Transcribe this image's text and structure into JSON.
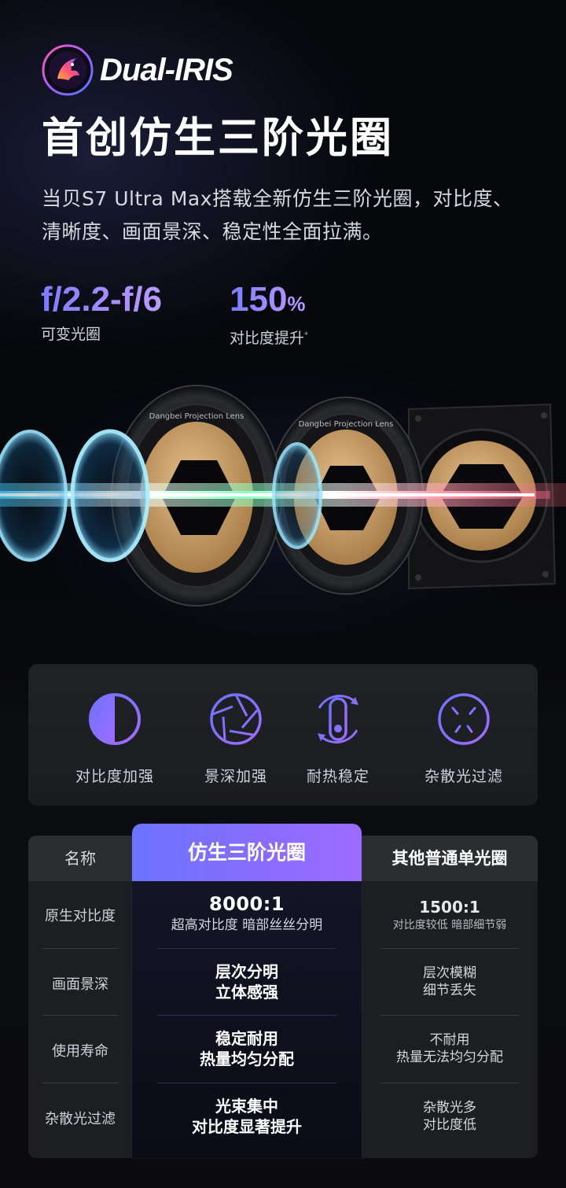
{
  "brand": {
    "name": "Dual-IRIS"
  },
  "headline": "首创仿生三阶光圈",
  "description": "当贝S7 Ultra Max搭载全新仿生三阶光圈，对比度、清晰度、画面景深、稳定性全面拉满。",
  "specs": [
    {
      "value": "f/2.2-f/6",
      "unit": "",
      "label": "可变光圈",
      "mark": ""
    },
    {
      "value": "150",
      "unit": "%",
      "label": "对比度提升",
      "mark": "*"
    }
  ],
  "lens_rings": [
    {
      "text": "Dangbei  Projection Lens"
    },
    {
      "text": "Dangbei  Projection Lens"
    }
  ],
  "features": [
    {
      "icon": "contrast-icon",
      "label": "对比度加强"
    },
    {
      "icon": "aperture-icon",
      "label": "景深加强"
    },
    {
      "icon": "thermometer-icon",
      "label": "耐热稳定"
    },
    {
      "icon": "stray-light-icon",
      "label": "杂散光过滤"
    }
  ],
  "comparison": {
    "headers": {
      "name": "名称",
      "featured": "仿生三阶光圈",
      "other": "其他普通单光圈"
    },
    "rows": [
      {
        "label": "原生对比度",
        "featured_main": "8000:1",
        "featured_sub": "超高对比度 暗部丝丝分明",
        "other_main": "1500:1",
        "other_sub": "对比度较低 暗部细节弱"
      },
      {
        "label": "画面景深",
        "featured_line1": "层次分明",
        "featured_line2": "立体感强",
        "other_line1": "层次模糊",
        "other_line2": "细节丢失"
      },
      {
        "label": "使用寿命",
        "featured_line1": "稳定耐用",
        "featured_line2": "热量均匀分配",
        "other_line1": "不耐用",
        "other_line2": "热量无法均匀分配"
      },
      {
        "label": "杂散光过滤",
        "featured_line1": "光束集中",
        "featured_line2": "对比度显著提升",
        "other_line1": "杂散光多",
        "other_line2": "对比度低"
      }
    ]
  },
  "colors": {
    "accent_start": "#6c73ff",
    "accent_end": "#9b6cff",
    "aperture_gold": "#c9a06a"
  }
}
